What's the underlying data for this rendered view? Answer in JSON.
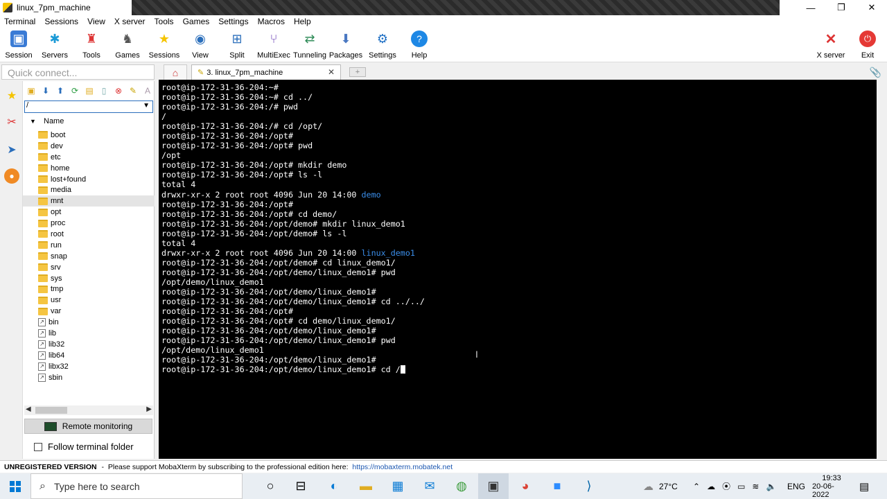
{
  "window": {
    "title": "linux_7pm_machine",
    "minimize": "—",
    "maximize": "❐",
    "close": "✕"
  },
  "menu": [
    "Terminal",
    "Sessions",
    "View",
    "X server",
    "Tools",
    "Games",
    "Settings",
    "Macros",
    "Help"
  ],
  "toolbar": {
    "items": [
      {
        "label": "Session",
        "icon": "session-icon"
      },
      {
        "label": "Servers",
        "icon": "servers-icon"
      },
      {
        "label": "Tools",
        "icon": "tools-icon"
      },
      {
        "label": "Games",
        "icon": "games-icon"
      },
      {
        "label": "Sessions",
        "icon": "star-icon"
      },
      {
        "label": "View",
        "icon": "view-icon"
      },
      {
        "label": "Split",
        "icon": "split-icon"
      },
      {
        "label": "MultiExec",
        "icon": "multiexec-icon"
      },
      {
        "label": "Tunneling",
        "icon": "tunneling-icon"
      },
      {
        "label": "Packages",
        "icon": "packages-icon"
      },
      {
        "label": "Settings",
        "icon": "gear-icon"
      },
      {
        "label": "Help",
        "icon": "help-icon"
      }
    ],
    "xserver_label": "X server",
    "exit_label": "Exit"
  },
  "quick_connect": {
    "placeholder": "Quick connect..."
  },
  "tabs": {
    "active_label": "3. linux_7pm_machine",
    "close": "✕",
    "add": "+"
  },
  "browser": {
    "path_value": "/",
    "column_header": "Name",
    "folders": [
      "boot",
      "dev",
      "etc",
      "home",
      "lost+found",
      "media",
      "mnt",
      "opt",
      "proc",
      "root",
      "run",
      "snap",
      "srv",
      "sys",
      "tmp",
      "usr",
      "var"
    ],
    "links": [
      "bin",
      "lib",
      "lib32",
      "lib64",
      "libx32",
      "sbin"
    ],
    "selected": "mnt",
    "remote_monitoring": "Remote monitoring",
    "follow_folder": "Follow terminal folder"
  },
  "terminal": {
    "lines": [
      {
        "t": "root@ip-172-31-36-204:~#"
      },
      {
        "t": "root@ip-172-31-36-204:~# cd ../"
      },
      {
        "t": "root@ip-172-31-36-204:/# pwd"
      },
      {
        "t": "/"
      },
      {
        "t": "root@ip-172-31-36-204:/# cd /opt/"
      },
      {
        "t": "root@ip-172-31-36-204:/opt#"
      },
      {
        "t": "root@ip-172-31-36-204:/opt# pwd"
      },
      {
        "t": "/opt"
      },
      {
        "t": "root@ip-172-31-36-204:/opt# mkdir demo"
      },
      {
        "t": "root@ip-172-31-36-204:/opt# ls -l"
      },
      {
        "t": "total 4"
      },
      {
        "t": "drwxr-xr-x 2 root root 4096 Jun 20 14:00 ",
        "blue": "demo"
      },
      {
        "t": "root@ip-172-31-36-204:/opt#"
      },
      {
        "t": "root@ip-172-31-36-204:/opt# cd demo/"
      },
      {
        "t": "root@ip-172-31-36-204:/opt/demo# mkdir linux_demo1"
      },
      {
        "t": "root@ip-172-31-36-204:/opt/demo# ls -l"
      },
      {
        "t": "total 4"
      },
      {
        "t": "drwxr-xr-x 2 root root 4096 Jun 20 14:00 ",
        "blue": "linux_demo1"
      },
      {
        "t": "root@ip-172-31-36-204:/opt/demo# cd linux_demo1/"
      },
      {
        "t": "root@ip-172-31-36-204:/opt/demo/linux_demo1# pwd"
      },
      {
        "t": "/opt/demo/linux_demo1"
      },
      {
        "t": "root@ip-172-31-36-204:/opt/demo/linux_demo1#"
      },
      {
        "t": "root@ip-172-31-36-204:/opt/demo/linux_demo1# cd ../../"
      },
      {
        "t": "root@ip-172-31-36-204:/opt#"
      },
      {
        "t": "root@ip-172-31-36-204:/opt# cd demo/linux_demo1/"
      },
      {
        "t": "root@ip-172-31-36-204:/opt/demo/linux_demo1#"
      },
      {
        "t": "root@ip-172-31-36-204:/opt/demo/linux_demo1# pwd"
      },
      {
        "t": "/opt/demo/linux_demo1"
      },
      {
        "t": "root@ip-172-31-36-204:/opt/demo/linux_demo1#"
      },
      {
        "t": "root@ip-172-31-36-204:/opt/demo/linux_demo1# cd /",
        "cursor": true
      }
    ]
  },
  "status": {
    "unregistered": "UNREGISTERED VERSION",
    "message": " -  Please support MobaXterm by subscribing to the professional edition here:  ",
    "link": "https://mobaxterm.mobatek.net"
  },
  "taskbar": {
    "search_placeholder": "Type here to search",
    "weather": "27°C",
    "lang": "ENG",
    "time": "19:33",
    "date": "20-06-2022"
  },
  "colors": {
    "terminal_bg": "#000000",
    "terminal_fg": "#ffffff",
    "dir_blue": "#3b8eea",
    "accent": "#0078d4"
  }
}
